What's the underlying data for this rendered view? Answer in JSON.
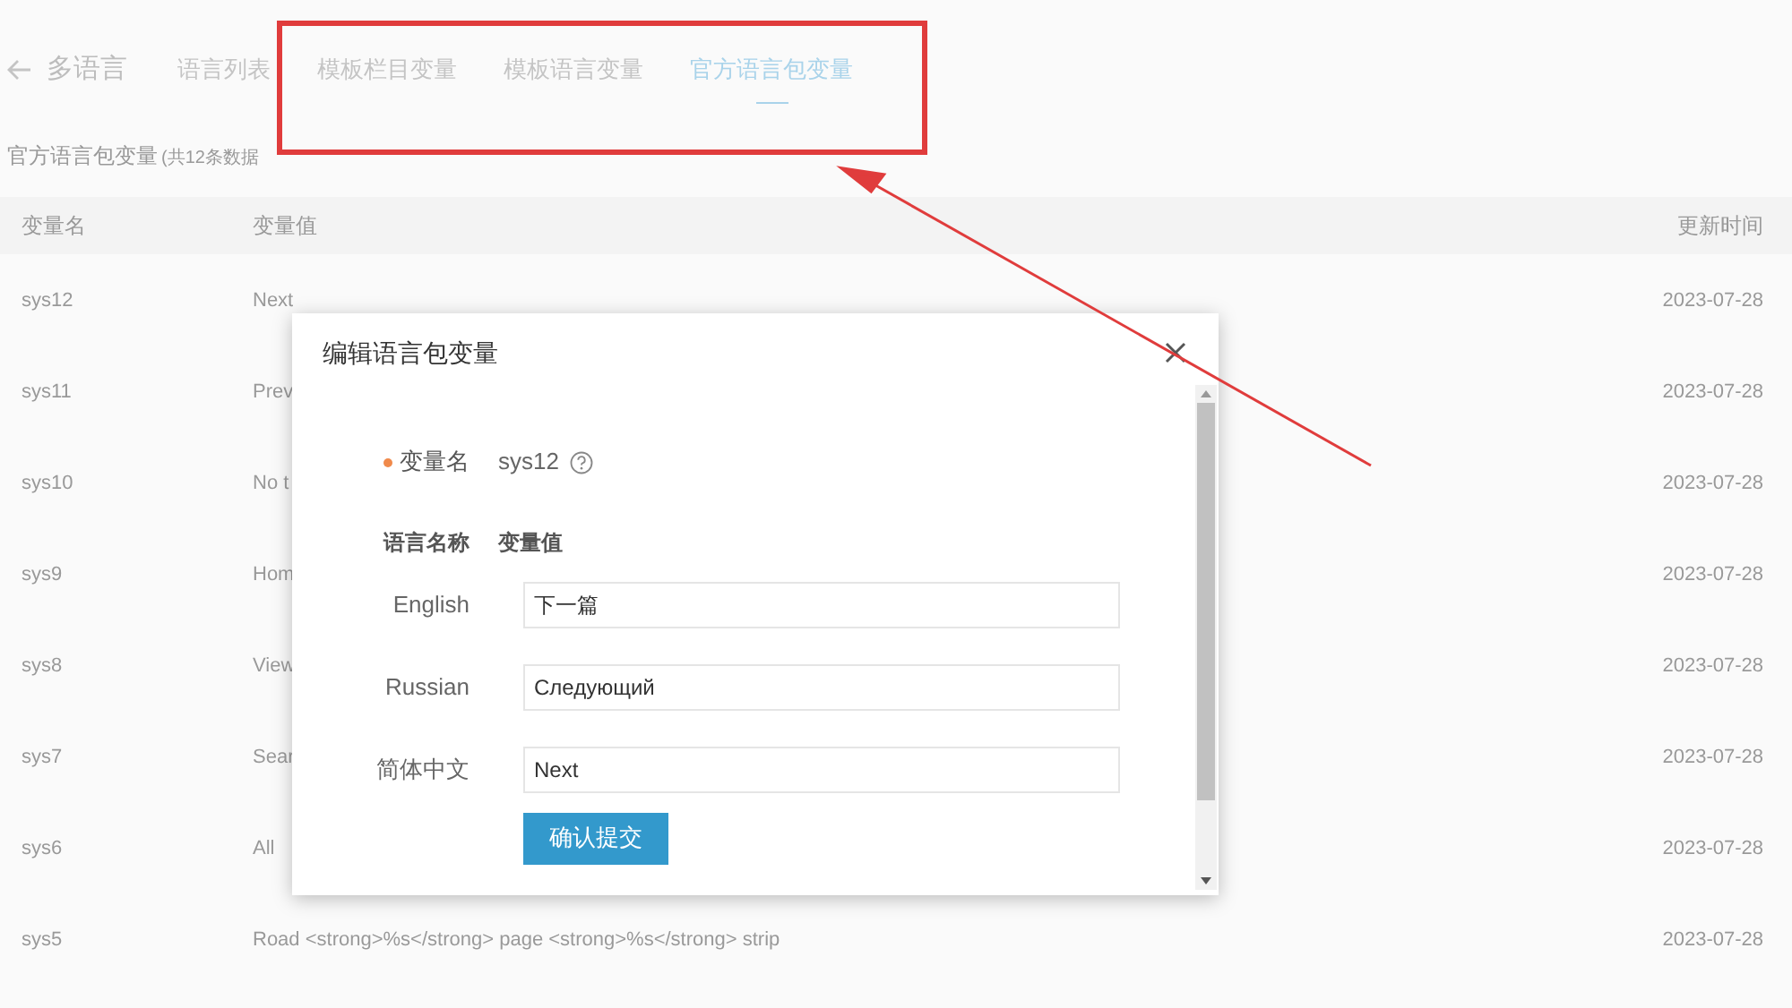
{
  "header": {
    "back_label": "多语言"
  },
  "tabs": [
    {
      "label": "语言列表",
      "selected": false
    },
    {
      "label": "模板栏目变量",
      "selected": false
    },
    {
      "label": "模板语言变量",
      "selected": false
    },
    {
      "label": "官方语言包变量",
      "selected": true
    }
  ],
  "section": {
    "title": "官方语言包变量",
    "count": "(共12条数据"
  },
  "table": {
    "columns": [
      "变量名",
      "变量值",
      "更新时间"
    ],
    "rows": [
      {
        "name": "sys12",
        "value": "Next",
        "updated": "2023-07-28"
      },
      {
        "name": "sys11",
        "value": "Prev",
        "updated": "2023-07-28"
      },
      {
        "name": "sys10",
        "value": "No t",
        "updated": "2023-07-28"
      },
      {
        "name": "sys9",
        "value": "Hom",
        "updated": "2023-07-28"
      },
      {
        "name": "sys8",
        "value": "View",
        "updated": "2023-07-28"
      },
      {
        "name": "sys7",
        "value": "Sear",
        "updated": "2023-07-28"
      },
      {
        "name": "sys6",
        "value": "All",
        "updated": "2023-07-28"
      },
      {
        "name": "sys5",
        "value": "Road <strong>%s</strong> page <strong>%s</strong> strip",
        "updated": "2023-07-28"
      }
    ]
  },
  "dialog": {
    "title": "编辑语言包变量",
    "name_label": "变量名",
    "required": true,
    "name_value": "sys12",
    "columns": [
      "语言名称",
      "变量值"
    ],
    "fields": [
      {
        "language": "English",
        "value": "下一篇"
      },
      {
        "language": "Russian",
        "value": "Следующий"
      },
      {
        "language": "简体中文",
        "value": "Next"
      }
    ],
    "submit": "确认提交"
  }
}
